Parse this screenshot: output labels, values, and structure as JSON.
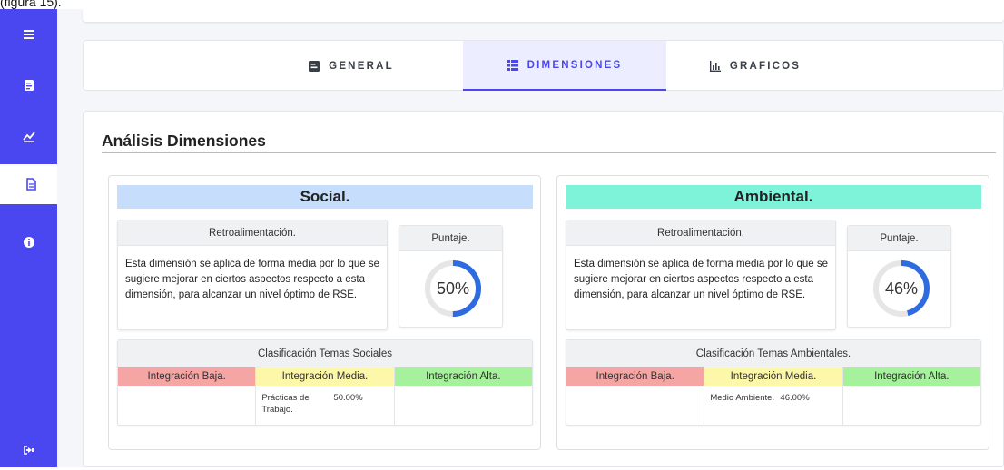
{
  "caption": "(figura 15).",
  "colors": {
    "sidebar": "#4a46f0",
    "tab_active": "#4a46f0",
    "social_header": "#c6ddfb",
    "ambiental_header": "#7ff3d9",
    "integracion_baja": "#f6a5a5",
    "integracion_media": "#fdf7a9",
    "integracion_alta": "#a6f19c",
    "ring": "#2f6be0"
  },
  "sidebar": [
    {
      "icon": "menu-icon"
    },
    {
      "icon": "file-icon"
    },
    {
      "icon": "chart-line-icon"
    },
    {
      "icon": "document-icon",
      "active": true
    },
    {
      "icon": "info-icon"
    },
    {
      "icon": "logout-icon"
    }
  ],
  "tabs": [
    {
      "label": "GENERAL",
      "icon": "list-box-icon"
    },
    {
      "label": "DIMENSIONES",
      "icon": "list-icon",
      "active": true
    },
    {
      "label": "GRAFICOS",
      "icon": "bar-chart-icon"
    }
  ],
  "analysis": {
    "title": "Análisis Dimensiones"
  },
  "dimensions": [
    {
      "name": "Social.",
      "feedback_title": "Retroalimentación.",
      "feedback_text": "Esta dimensión se aplica de forma media por lo que se sugiere mejorar en ciertos aspectos respecto a esta dimensión, para alcanzar un nivel óptimo de RSE.",
      "score_title": "Puntaje.",
      "score": 0.5,
      "score_label": "50%",
      "classification_title": "Clasificación Temas Sociales",
      "levels": [
        "Integración Baja.",
        "Integración Media.",
        "Integración Alta."
      ],
      "media_topic": "Prácticas de Trabajo.",
      "media_pct": "50.00%"
    },
    {
      "name": "Ambiental.",
      "feedback_title": "Retroalimentación.",
      "feedback_text": "Esta dimensión se aplica de forma media por lo que se sugiere mejorar en ciertos aspectos respecto a esta dimensión, para alcanzar un nivel óptimo de RSE.",
      "score_title": "Puntaje.",
      "score": 0.46,
      "score_label": "46%",
      "classification_title": "Clasificación Temas Ambientales.",
      "levels": [
        "Integración Baja.",
        "Integración Media.",
        "Integración Alta."
      ],
      "media_topic": "Medio Ambiente.",
      "media_pct": "46.00%"
    }
  ]
}
